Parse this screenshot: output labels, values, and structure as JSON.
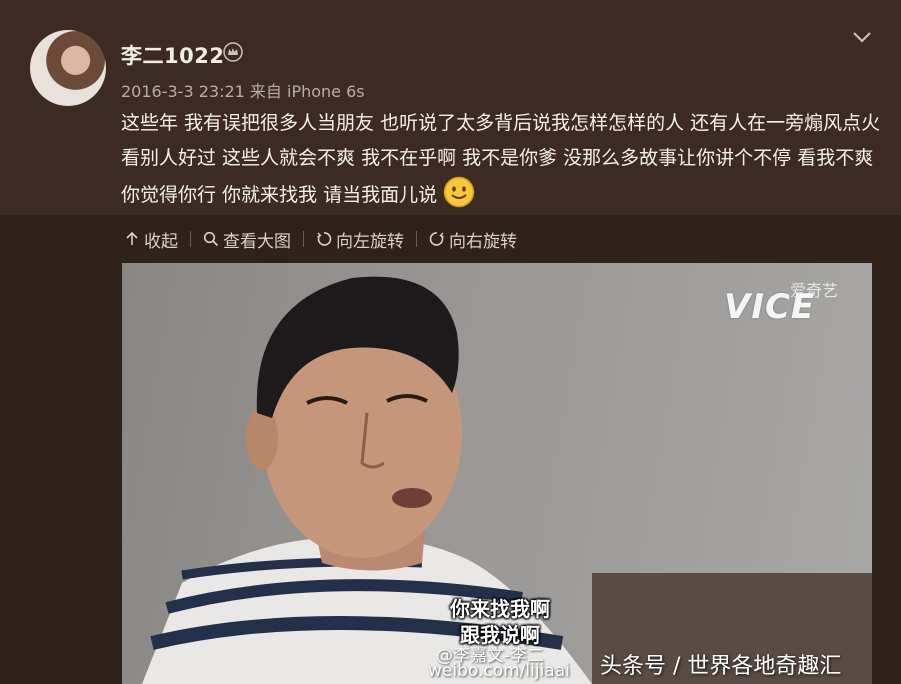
{
  "post": {
    "username": "李二1022",
    "timestamp": "2016-3-3 23:21",
    "source": "来自 iPhone 6s",
    "text": "这些年 我有误把很多人当朋友 也听说了太多背后说我怎样怎样的人 还有人在一旁煽风点火 看别人好过 这些人就会不爽 我不在乎啊 我不是你爹 没那么多故事让你讲个不停 看我不爽 你觉得你行 你就来找我 请当我面儿说"
  },
  "toolbar": {
    "collapse": "收起",
    "view_large": "查看大图",
    "rotate_left": "向左旋转",
    "rotate_right": "向右旋转"
  },
  "image": {
    "channel_logo": "VICE",
    "channel_watermark": "爱奇艺",
    "subtitle_line1": "你来找我啊",
    "subtitle_line2": "跟我说啊",
    "watermark_line1": "@李嘉文-李二",
    "watermark_line2": "weibo.com/lijiaai"
  },
  "footer": {
    "source_credit": "头条号 / 世界各地奇趣汇"
  },
  "icons": [
    "crown-icon",
    "chevron-down-icon",
    "smile-emoji-icon",
    "arrow-up-icon",
    "search-icon",
    "rotate-left-icon",
    "rotate-right-icon"
  ],
  "colors": {
    "background_top": "#3b2b22",
    "background_bottom": "#2e221b",
    "text_primary": "#f4f0ec",
    "text_meta": "#b9aea6"
  }
}
